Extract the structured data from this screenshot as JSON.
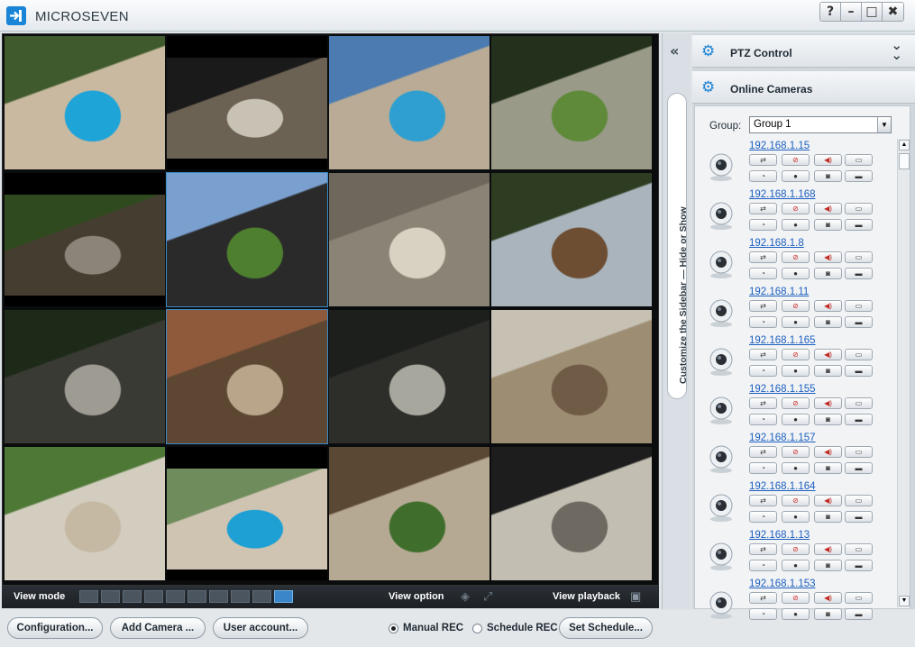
{
  "window": {
    "title": "MICROSEVEN",
    "help_label": "?",
    "minimize_label": "–",
    "maximize_label": "□",
    "close_label": "✖"
  },
  "grid": {
    "rows": 4,
    "cols": 4,
    "selected_cells": [
      9,
      5
    ]
  },
  "view_bar": {
    "view_mode_label": "View mode",
    "view_option_label": "View option",
    "view_playback_label": "View playback",
    "active_layout_index": 9
  },
  "bottom_bar": {
    "configuration": "Configuration...",
    "add_camera": "Add Camera ...",
    "user_account": "User account...",
    "manual_rec": "Manual REC",
    "schedule_rec": "Schedule REC",
    "set_schedule": "Set Schedule...",
    "selected_rec_mode": "Manual REC"
  },
  "sidebar": {
    "toggle_text": "Customize the Sidebar — Hide or Show",
    "collapse_icon": "double-chevron-left-icon",
    "ptz_title": "PTZ Control",
    "online_title": "Online Cameras",
    "group_label": "Group:",
    "group_value": "Group 1",
    "cameras": [
      {
        "ip": "192.168.1.15"
      },
      {
        "ip": "192.168.1.168"
      },
      {
        "ip": "192.168.1.8"
      },
      {
        "ip": "192.168.1.11"
      },
      {
        "ip": "192.168.1.165"
      },
      {
        "ip": "192.168.1.155"
      },
      {
        "ip": "192.168.1.157"
      },
      {
        "ip": "192.168.1.164"
      },
      {
        "ip": "192.168.1.13"
      },
      {
        "ip": "192.168.1.153"
      }
    ]
  },
  "colors": {
    "accent": "#1d83d4",
    "link": "#1d5fbf",
    "video_bg": "#0b0c0d"
  }
}
